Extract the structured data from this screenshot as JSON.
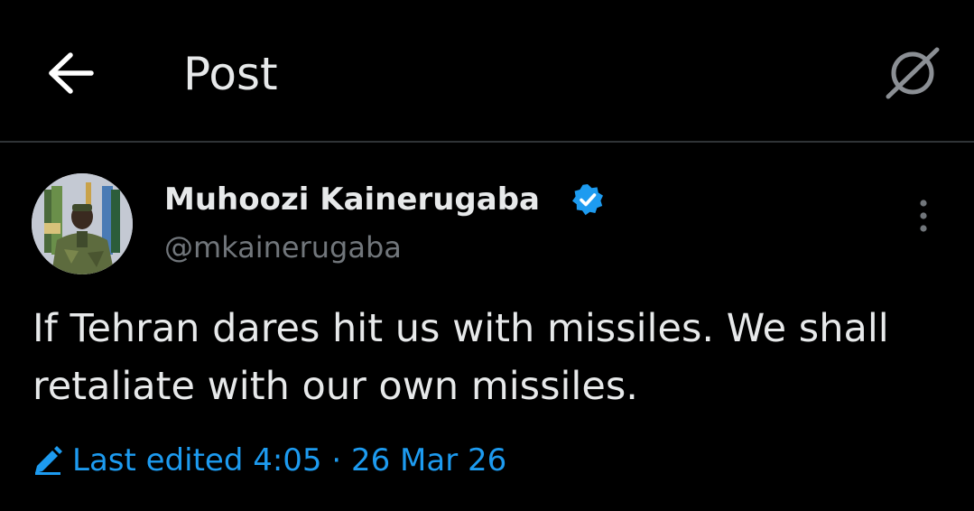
{
  "header": {
    "title": "Post",
    "back_icon": "arrow-left-icon",
    "grok_icon": "grok-icon"
  },
  "post": {
    "author": {
      "display_name": "Muhoozi Kainerugaba",
      "handle": "@mkainerugaba",
      "verified_icon": "verified-badge-icon",
      "avatar": "avatar"
    },
    "more_icon": "more-vertical-icon",
    "text": "If Tehran dares hit us with missiles. We shall retaliate with our own missiles.",
    "edited": {
      "icon": "pencil-icon",
      "label": "Last edited 4:05 · 26 Mar 26"
    }
  },
  "colors": {
    "background": "#000000",
    "text_primary": "#e7e9ea",
    "text_secondary": "#71767b",
    "accent": "#1d9bf0",
    "divider": "#2f3336"
  }
}
